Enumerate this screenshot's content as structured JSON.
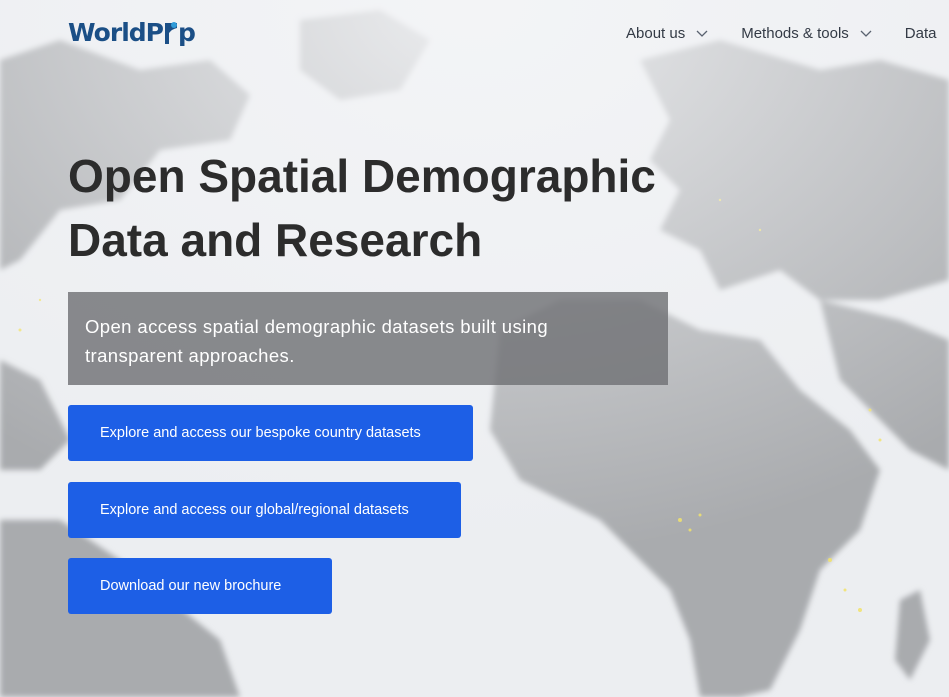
{
  "brand": {
    "logo_text_left": "WorldP",
    "logo_text_right": "p"
  },
  "nav": {
    "items": [
      {
        "label": "About us"
      },
      {
        "label": "Methods & tools"
      },
      {
        "label": "Data"
      }
    ]
  },
  "hero": {
    "title": "Open Spatial Demographic Data and Research",
    "subtitle": "Open access spatial demographic datasets built using transparent approaches.",
    "buttons": [
      {
        "label": "Explore and access our bespoke country datasets"
      },
      {
        "label": "Explore and access our global/regional datasets"
      },
      {
        "label": "Download our new brochure"
      }
    ]
  },
  "colors": {
    "brand_blue": "#1b4f86",
    "cta_blue": "#1d5fe6",
    "title_text": "#2c2c2c",
    "nav_text": "#333a45"
  },
  "icons": {
    "nav_dropdown": "chevron-down-icon"
  }
}
